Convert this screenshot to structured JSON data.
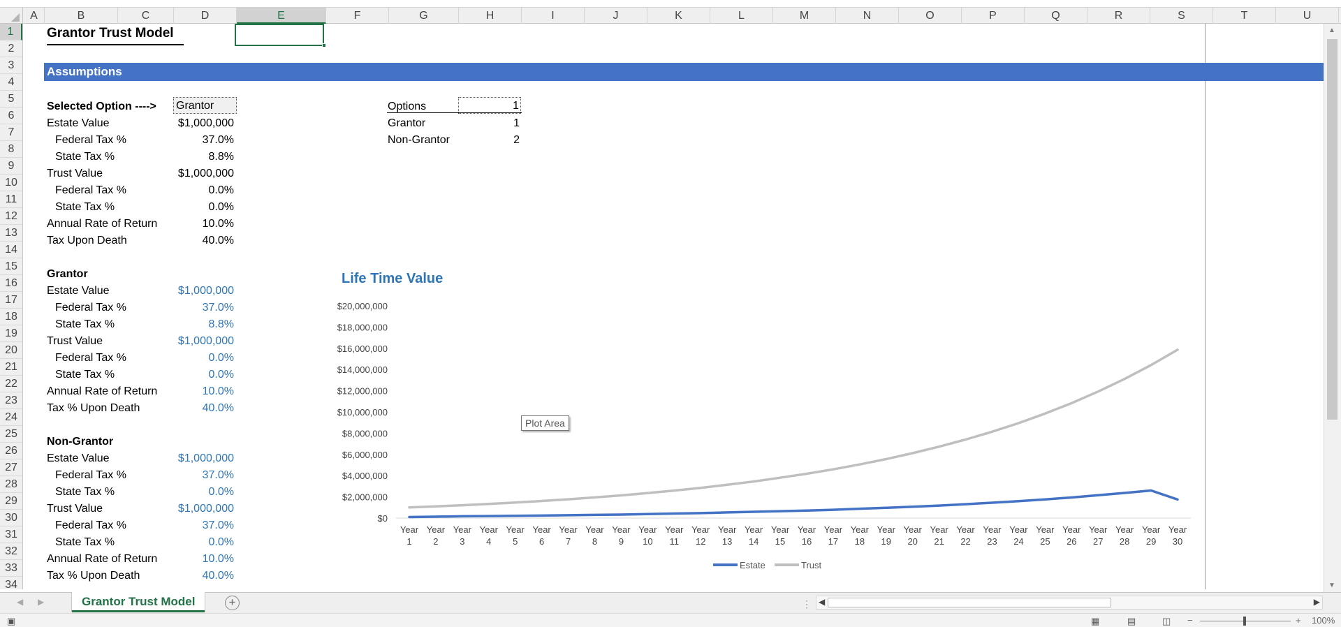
{
  "columns": [
    "A",
    "B",
    "C",
    "D",
    "E",
    "F",
    "G",
    "H",
    "I",
    "J",
    "K",
    "L",
    "M",
    "N",
    "O",
    "P",
    "Q",
    "R",
    "S",
    "T",
    "U"
  ],
  "selected_column": "E",
  "rows": [
    "1",
    "2",
    "3",
    "4",
    "5",
    "6",
    "7",
    "8",
    "9",
    "10",
    "11",
    "12",
    "13",
    "14",
    "15",
    "16",
    "17",
    "18",
    "19",
    "20",
    "21",
    "22",
    "23",
    "24",
    "25",
    "26",
    "27",
    "28",
    "29",
    "30",
    "31",
    "32",
    "33",
    "34"
  ],
  "selected_row": "1",
  "sheet": {
    "title": "Grantor Trust Model",
    "banner": "Assumptions",
    "selected_option": {
      "label": "Selected Option ---->",
      "value": "Grantor"
    },
    "assumptions": [
      {
        "label": "Estate Value",
        "value": "$1,000,000",
        "indent": false
      },
      {
        "label": "Federal Tax %",
        "value": "37.0%",
        "indent": true
      },
      {
        "label": "State Tax %",
        "value": "8.8%",
        "indent": true
      },
      {
        "label": "Trust Value",
        "value": "$1,000,000",
        "indent": false
      },
      {
        "label": "Federal Tax %",
        "value": "0.0%",
        "indent": true
      },
      {
        "label": "State Tax %",
        "value": "0.0%",
        "indent": true
      },
      {
        "label": "Annual Rate of Return",
        "value": "10.0%",
        "indent": false
      },
      {
        "label": "Tax Upon Death",
        "value": "40.0%",
        "indent": false
      }
    ],
    "options": {
      "header": "Options",
      "header_value": "1",
      "items": [
        {
          "label": "Grantor",
          "value": "1"
        },
        {
          "label": "Non-Grantor",
          "value": "2"
        }
      ]
    },
    "grantor": {
      "heading": "Grantor",
      "rows": [
        {
          "label": "Estate Value",
          "value": "$1,000,000",
          "indent": false
        },
        {
          "label": "Federal Tax %",
          "value": "37.0%",
          "indent": true
        },
        {
          "label": "State Tax %",
          "value": "8.8%",
          "indent": true
        },
        {
          "label": "Trust Value",
          "value": "$1,000,000",
          "indent": false
        },
        {
          "label": "Federal Tax %",
          "value": "0.0%",
          "indent": true
        },
        {
          "label": "State Tax %",
          "value": "0.0%",
          "indent": true
        },
        {
          "label": "Annual Rate of Return",
          "value": "10.0%",
          "indent": false
        },
        {
          "label": "Tax % Upon Death",
          "value": "40.0%",
          "indent": false
        }
      ]
    },
    "non_grantor": {
      "heading": "Non-Grantor",
      "rows": [
        {
          "label": "Estate Value",
          "value": "$1,000,000",
          "indent": false
        },
        {
          "label": "Federal Tax %",
          "value": "37.0%",
          "indent": true
        },
        {
          "label": "State Tax %",
          "value": "0.0%",
          "indent": true
        },
        {
          "label": "Trust Value",
          "value": "$1,000,000",
          "indent": false
        },
        {
          "label": "Federal Tax %",
          "value": "37.0%",
          "indent": true
        },
        {
          "label": "State Tax %",
          "value": "0.0%",
          "indent": true
        },
        {
          "label": "Annual Rate of Return",
          "value": "10.0%",
          "indent": false
        },
        {
          "label": "Tax % Upon Death",
          "value": "40.0%",
          "indent": false
        }
      ]
    }
  },
  "chart_tooltip": "Plot Area",
  "chart_data": {
    "type": "line",
    "title": "Life Time Value",
    "xlabel": "",
    "ylabel": "",
    "ylim": [
      0,
      20000000
    ],
    "y_ticks": [
      "$0",
      "$2,000,000",
      "$4,000,000",
      "$6,000,000",
      "$8,000,000",
      "$10,000,000",
      "$12,000,000",
      "$14,000,000",
      "$16,000,000",
      "$18,000,000",
      "$20,000,000"
    ],
    "x_prefix": "Year",
    "x": [
      1,
      2,
      3,
      4,
      5,
      6,
      7,
      8,
      9,
      10,
      11,
      12,
      13,
      14,
      15,
      16,
      17,
      18,
      19,
      20,
      21,
      22,
      23,
      24,
      25,
      26,
      27,
      28,
      29,
      30
    ],
    "grid": false,
    "legend": "bottom",
    "series": [
      {
        "name": "Estate",
        "color": "#4472c4",
        "values": [
          100000,
          130000,
          170000,
          190000,
          210000,
          240000,
          270000,
          300000,
          330000,
          380000,
          430000,
          470000,
          530000,
          590000,
          650000,
          710000,
          780000,
          880000,
          970000,
          1070000,
          1180000,
          1310000,
          1450000,
          1600000,
          1760000,
          1940000,
          2150000,
          2370000,
          2600000,
          1750000
        ]
      },
      {
        "name": "Trust",
        "color": "#bfbfbf",
        "values": [
          1000000,
          1100000,
          1210000,
          1330000,
          1460000,
          1610000,
          1770000,
          1950000,
          2140000,
          2360000,
          2590000,
          2850000,
          3140000,
          3450000,
          3800000,
          4180000,
          4590000,
          5050000,
          5560000,
          6120000,
          6730000,
          7400000,
          8140000,
          8950000,
          9850000,
          10830000,
          11920000,
          13110000,
          14420000,
          15860000
        ]
      }
    ]
  },
  "tab_bar": {
    "active_sheet": "Grantor Trust Model",
    "add_label": "+"
  },
  "status_bar": {
    "zoom": "100%"
  },
  "colors": {
    "accent": "#217346",
    "banner": "#4472c4",
    "input_blue": "#2e75b6"
  }
}
